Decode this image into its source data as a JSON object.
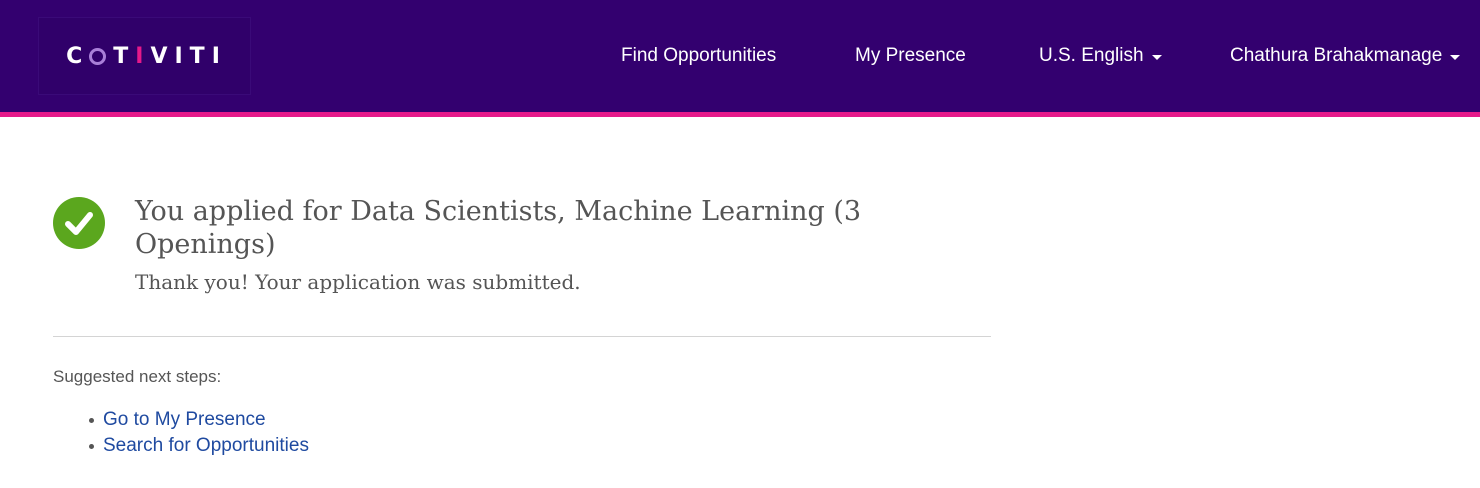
{
  "header": {
    "logo": {
      "text_before": "C",
      "text_after_o": "T",
      "text_i": "I",
      "text_end": "VITI",
      "colors": {
        "o_ring": "#a97fd8",
        "i_accent": "#e6198a"
      }
    },
    "nav": {
      "find_opportunities": "Find Opportunities",
      "my_presence": "My Presence",
      "language": "U.S. English",
      "user": "Chathura Brahakmanage"
    },
    "colors": {
      "bar": "#33006f",
      "accent_line": "#e6198a"
    }
  },
  "confirmation": {
    "title": "You applied for Data Scientists, Machine Learning (3 Openings)",
    "message": "Thank you! Your application was submitted.",
    "icon": "check-circle-icon",
    "icon_color": "#5ba71e"
  },
  "next_steps": {
    "label": "Suggested next steps:",
    "items": [
      {
        "label": "Go to My Presence"
      },
      {
        "label": "Search for Opportunities"
      }
    ],
    "link_color": "#1f4aa0"
  }
}
